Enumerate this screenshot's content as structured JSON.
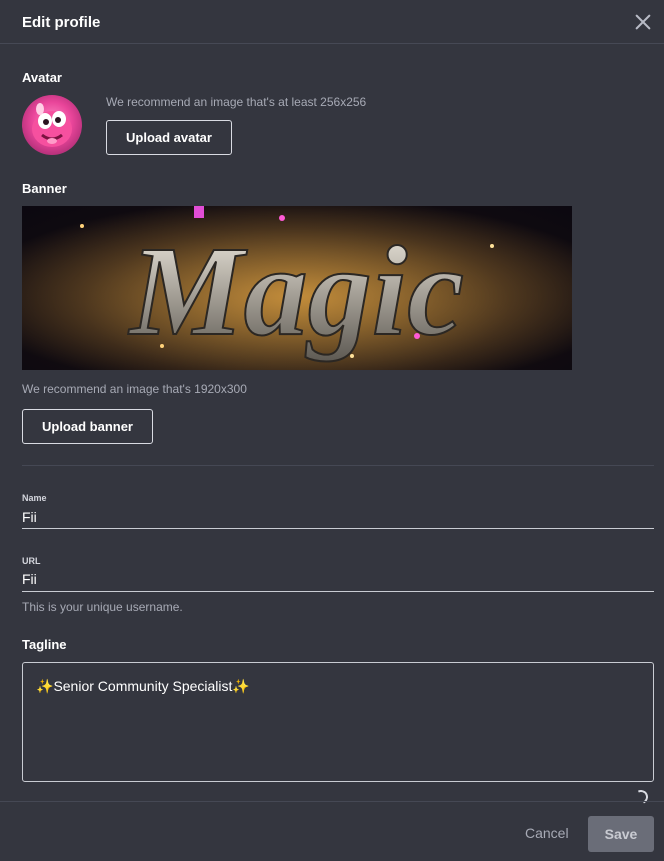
{
  "header": {
    "title": "Edit profile"
  },
  "avatar_section": {
    "label": "Avatar",
    "hint": "We recommend an image that's at least 256x256",
    "upload_label": "Upload avatar"
  },
  "banner_section": {
    "label": "Banner",
    "image_text": "Magic",
    "hint": "We recommend an image that's 1920x300",
    "upload_label": "Upload banner"
  },
  "name_field": {
    "label": "Name",
    "value": "Fii"
  },
  "url_field": {
    "label": "URL",
    "value": "Fii",
    "helper": "This is your unique username."
  },
  "tagline": {
    "label": "Tagline",
    "spark_left": "✨",
    "text": "Senior Community Specialist",
    "spark_right": "✨"
  },
  "footer": {
    "cancel_label": "Cancel",
    "save_label": "Save"
  },
  "colors": {
    "background": "#34363f",
    "text": "#ffffff",
    "muted": "#a7aab5",
    "save_disabled": "#6a6d78"
  },
  "icons": {
    "close": "close-icon",
    "loading": "spinner-icon"
  }
}
